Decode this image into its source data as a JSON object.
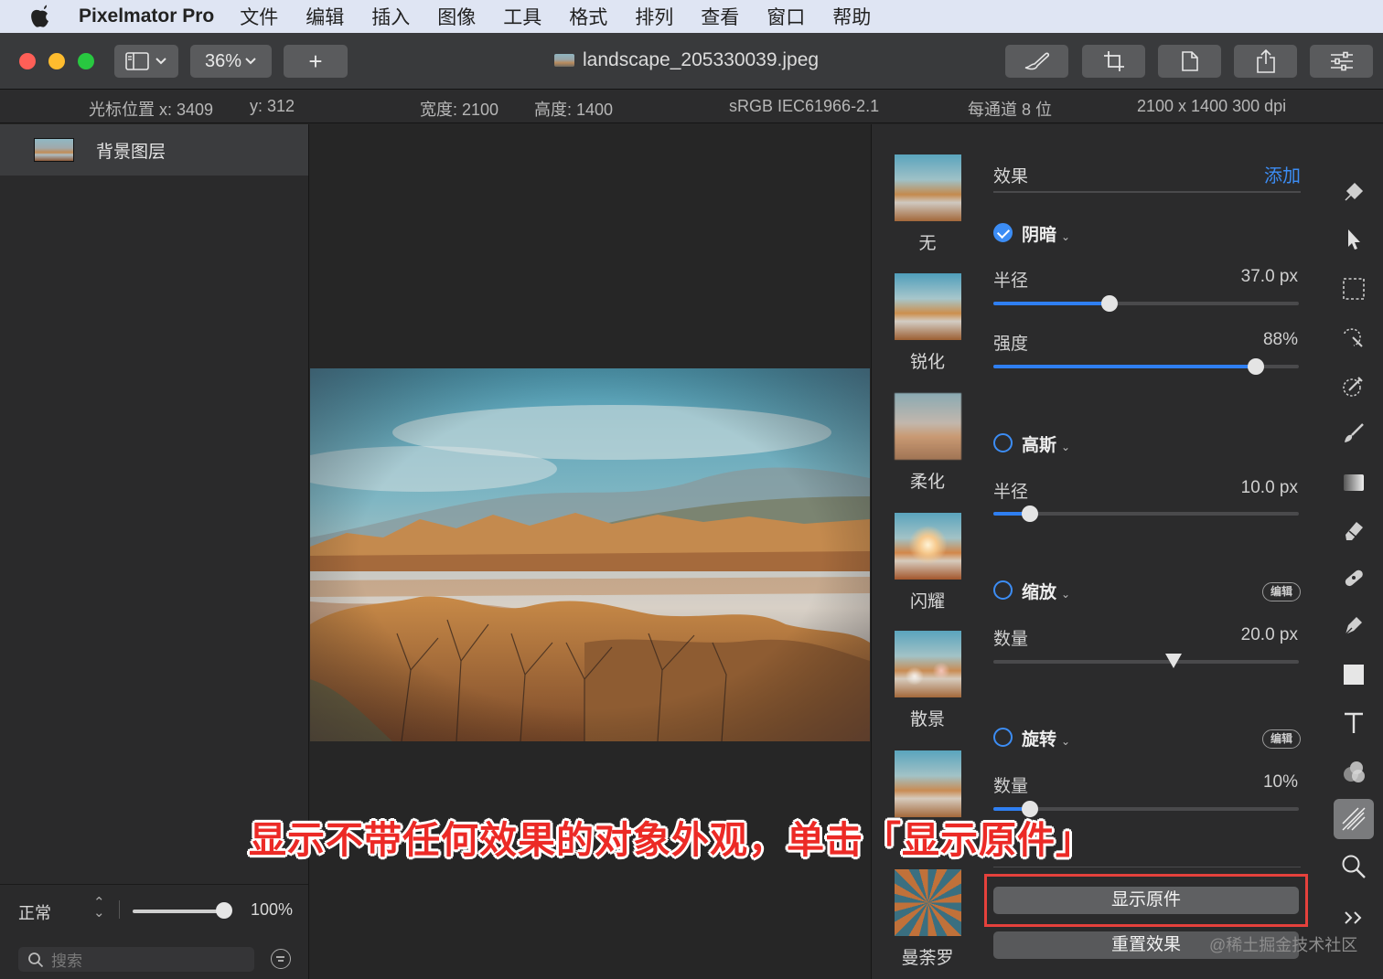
{
  "menubar": {
    "app_name": "Pixelmator Pro",
    "items": [
      "文件",
      "编辑",
      "插入",
      "图像",
      "工具",
      "格式",
      "排列",
      "查看",
      "窗口",
      "帮助"
    ]
  },
  "toolbar": {
    "zoom": "36%",
    "add_symbol": "+",
    "doc_title": "landscape_205330039.jpeg",
    "buttons": [
      "brush-edit-icon",
      "crop-icon",
      "document-icon",
      "share-icon",
      "adjust-icon"
    ]
  },
  "infobar": {
    "cursor_x": "光标位置 x:  3409",
    "cursor_y": "y:  312",
    "width": "宽度:  2100",
    "height": "高度:  1400",
    "color_profile": "sRGB IEC61966-2.1",
    "bit_depth": "每通道 8 位",
    "dimensions": "2100 x 1400 300 dpi"
  },
  "layers": {
    "items": [
      {
        "name": "背景图层"
      }
    ],
    "blend_mode": "正常",
    "opacity": "100%",
    "opacity_fraction": 1.0,
    "search_placeholder": "搜索"
  },
  "effect_presets": [
    {
      "label": "无"
    },
    {
      "label": "锐化"
    },
    {
      "label": "柔化"
    },
    {
      "label": "闪耀"
    },
    {
      "label": "散景"
    },
    {
      "label": ""
    },
    {
      "label": "曼荼罗"
    }
  ],
  "effects_panel": {
    "header": "效果",
    "add_label": "添加",
    "effects": [
      {
        "name": "阴暗",
        "enabled": true,
        "params": [
          {
            "label": "半径",
            "value": "37.0 px",
            "fraction": 0.38
          },
          {
            "label": "强度",
            "value": "88%",
            "fraction": 0.86
          }
        ]
      },
      {
        "name": "高斯",
        "enabled": false,
        "params": [
          {
            "label": "半径",
            "value": "10.0 px",
            "fraction": 0.12
          }
        ]
      },
      {
        "name": "缩放",
        "enabled": false,
        "edit_label": "编辑",
        "params": [
          {
            "label": "数量",
            "value": "20.0 px",
            "fraction": 0.59
          }
        ]
      },
      {
        "name": "旋转",
        "enabled": false,
        "edit_label": "编辑",
        "params": [
          {
            "label": "数量",
            "value": "10%",
            "fraction": 0.12
          }
        ]
      }
    ],
    "show_original_label": "显示原件",
    "reset_label": "重置效果"
  },
  "tools": [
    "style-icon",
    "arrange-icon",
    "selection-icon",
    "magic-select-icon",
    "color-picker-icon",
    "paint-brush-icon",
    "gradient-icon",
    "eraser-icon",
    "repair-icon",
    "pen-icon",
    "shape-icon",
    "type-icon",
    "color-adjust-icon",
    "effects-icon",
    "zoom-icon",
    "more-icon"
  ],
  "annotation": "显示不带任何效果的对象外观，单击「显示原件」",
  "watermark": "@稀土掘金技术社区",
  "colors": {
    "accent": "#2f7ff2",
    "highlight_box": "#e5413c",
    "annotation_text": "#ec2a26"
  }
}
